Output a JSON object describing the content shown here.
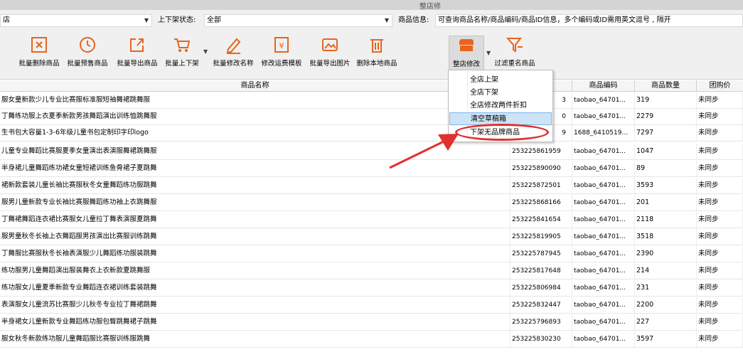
{
  "window": {
    "title": "整店修"
  },
  "filters": {
    "shop_value": "店",
    "status_label": "上下架状态:",
    "status_value": "全部",
    "info_label": "商品信息:",
    "info_placeholder": "可查询商品名称/商品编码/商品ID信息，多个编码或ID需用英文逗号 , 隔开"
  },
  "toolbar": {
    "tools": [
      {
        "label": "批量删除商品",
        "icon": "delete-box-icon"
      },
      {
        "label": "批量预售商品",
        "icon": "presale-clock-icon"
      },
      {
        "label": "批量导出商品",
        "icon": "export-icon"
      },
      {
        "label": "批量上下架",
        "icon": "cart-icon"
      },
      {
        "label": "批量修改名称",
        "icon": "pencil-icon"
      },
      {
        "label": "修改运费模板",
        "icon": "yen-template-icon"
      },
      {
        "label": "批量导出图片",
        "icon": "export-image-icon"
      },
      {
        "label": "删除本地商品",
        "icon": "trash-icon"
      },
      {
        "label": "整店修改",
        "icon": "shop-icon"
      },
      {
        "label": "过滤重名商品",
        "icon": "filter-icon"
      }
    ]
  },
  "columns": {
    "name": "商品名称",
    "id": "",
    "code": "商品编码",
    "qty": "商品数量",
    "group": "团购价"
  },
  "dropdown_menu": {
    "items": [
      "全店上架",
      "全店下架",
      "全店修改两件折扣",
      "清空草稿箱",
      "下架无品牌商品"
    ],
    "highlighted_index": 3,
    "circled_index": 4
  },
  "rows": [
    {
      "name": "服女童新款少儿专业比赛服标准服短袖舞裙跳舞服",
      "id": "3",
      "code": "taobao_64701...",
      "qty": "319",
      "group": "未同步"
    },
    {
      "name": "丁舞练功服上衣夏季新款男孩舞蹈演出训练恤跳舞服",
      "id": "0",
      "code": "taobao_64701...",
      "qty": "2279",
      "group": "未同步"
    },
    {
      "name": "生书包大容量1-3-6年级儿童书包定制印字印logo",
      "id": "9",
      "code": "1688_6410519...",
      "qty": "7297",
      "group": "未同步"
    },
    {
      "name": "儿童专业舞蹈比赛服夏季女童演出表演服舞裙跳舞服",
      "id": "253225861959",
      "code": "taobao_64701...",
      "qty": "1047",
      "group": "未同步"
    },
    {
      "name": "半身裙儿童舞蹈练功裙女童短裙训练鱼骨裙子夏跳舞",
      "id": "253225890090",
      "code": "taobao_64701...",
      "qty": "89",
      "group": "未同步"
    },
    {
      "name": "裙新款套装儿童长袖比赛服秋冬女童舞蹈练功服跳舞",
      "id": "253225872501",
      "code": "taobao_64701...",
      "qty": "3593",
      "group": "未同步"
    },
    {
      "name": "服男儿童新款专业长袖比赛服舞蹈练功袖上衣跳舞服",
      "id": "253225868166",
      "code": "taobao_64701...",
      "qty": "201",
      "group": "未同步"
    },
    {
      "name": "丁舞裙舞蹈连衣裙比赛服女儿童拉丁舞表演服夏跳舞",
      "id": "253225841654",
      "code": "taobao_64701...",
      "qty": "2118",
      "group": "未同步"
    },
    {
      "name": "服男童秋冬长袖上衣舞蹈服男孩演出比赛服训练跳舞",
      "id": "253225819905",
      "code": "taobao_64701...",
      "qty": "3518",
      "group": "未同步"
    },
    {
      "name": "丁舞服比赛服秋冬长袖表演服少儿舞蹈练功服装跳舞",
      "id": "253225787945",
      "code": "taobao_64701...",
      "qty": "2390",
      "group": "未同步"
    },
    {
      "name": "练功服男儿童舞蹈演出服装舞衣上衣新款夏跳舞服",
      "id": "253225817648",
      "code": "taobao_64701...",
      "qty": "214",
      "group": "未同步"
    },
    {
      "name": "练功服女儿童夏季新款专业舞蹈连衣裙训练套装跳舞",
      "id": "253225806984",
      "code": "taobao_64701...",
      "qty": "231",
      "group": "未同步"
    },
    {
      "name": "表演服女儿童流苏比赛服少儿秋冬专业拉丁舞裙跳舞",
      "id": "253225832447",
      "code": "taobao_64701...",
      "qty": "2200",
      "group": "未同步"
    },
    {
      "name": "半身裙女儿童新款专业舞蹈练功服包臀跳舞裙子跳舞",
      "id": "253225796893",
      "code": "taobao_64701...",
      "qty": "227",
      "group": "未同步"
    },
    {
      "name": "服女秋冬新款练功服儿童舞蹈服比赛服训练服跳舞",
      "id": "253225830230",
      "code": "taobao_64701...",
      "qty": "3597",
      "group": "未同步"
    }
  ],
  "colors": {
    "accent_orange": "#e8641e",
    "annotation_red": "#e03030",
    "highlight": "#cce4f7"
  }
}
